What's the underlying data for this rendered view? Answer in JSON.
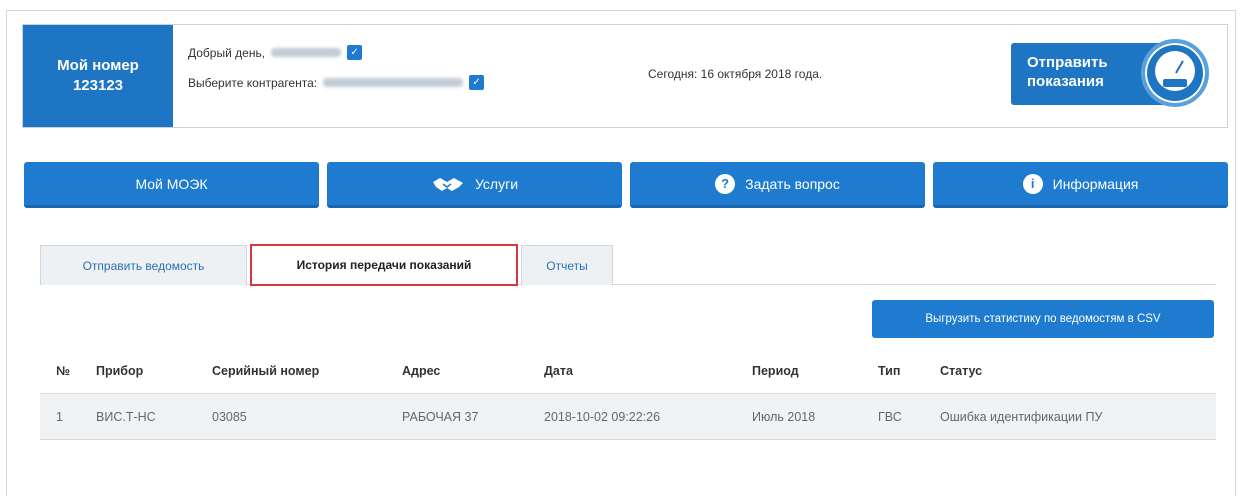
{
  "header": {
    "account_label": "Мой номер",
    "account_number": "123123",
    "greeting_label": "Добрый день,",
    "contractor_label": "Выберите контрагента:",
    "today_text": "Сегодня: 16 октября 2018 года.",
    "send_readings_line1": "Отправить",
    "send_readings_line2": "показания"
  },
  "nav": {
    "items": [
      {
        "label": "Мой МОЭК",
        "icon": "none"
      },
      {
        "label": "Услуги",
        "icon": "handshake-icon"
      },
      {
        "label": "Задать вопрос",
        "icon": "question-icon"
      },
      {
        "label": "Информация",
        "icon": "info-icon"
      }
    ]
  },
  "tabs": [
    {
      "label": "Отправить ведомость",
      "active": false
    },
    {
      "label": "История передачи показаний",
      "active": true
    },
    {
      "label": "Отчеты",
      "active": false
    }
  ],
  "export_label": "Выгрузить статистику по ведомостям в CSV",
  "table": {
    "columns": [
      "№",
      "Прибор",
      "Серийный номер",
      "Адрес",
      "Дата",
      "Период",
      "Тип",
      "Статус"
    ],
    "rows": [
      [
        "1",
        "ВИС.Т-НС",
        "03085",
        "РАБОЧАЯ 37",
        "2018-10-02 09:22:26",
        "Июль 2018",
        "ГВС",
        "Ошибка идентификации ПУ"
      ]
    ]
  },
  "colors": {
    "primary": "#1e7bd0",
    "active_tab_border": "#d9363e"
  }
}
